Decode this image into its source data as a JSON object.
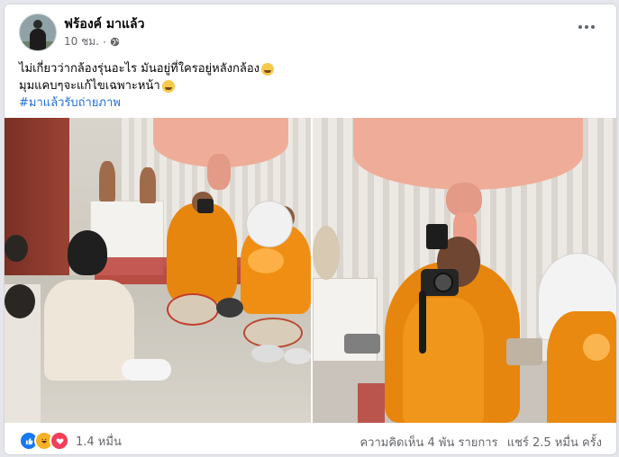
{
  "post": {
    "author": "ฟร้องค์ มาแล้ว",
    "time": "10 ชม.",
    "privacy_icon": "globe-icon",
    "line1": "ไม่เกี่ยวว่ากล้องรุ่นอะไร มันอยู่ที่ใครอยู่หลังกล้อง",
    "line2": "มุมแคบๆจะแก้ไขเฉพาะหน้า",
    "hashtag": "#มาแล้วรับถ่ายภาพ",
    "emoji_icon": "rofl-emoji-icon"
  },
  "reactions": {
    "icons": [
      "like-icon",
      "haha-icon",
      "love-icon"
    ],
    "count": "1.4 หมื่น"
  },
  "stats": {
    "comments": "ความคิดเห็น 4 พัน รายการ",
    "shares": "แชร์ 2.5 หมื่น ครั้ง"
  },
  "colors": {
    "link": "#216fdb",
    "like": "#1877f2",
    "love": "#f33e58",
    "haha": "#f7b125",
    "robe": "#e6860f",
    "curtain": "#efad99"
  }
}
